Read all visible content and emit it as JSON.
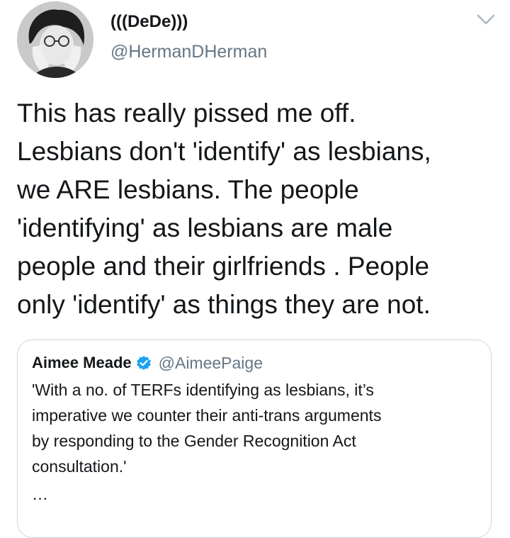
{
  "author": {
    "display_name": "(((DeDe)))",
    "handle": "@HermanDHerman",
    "avatar_icon": "user-avatar"
  },
  "tweet": {
    "text": "This has really pissed me off.\nLesbians don't 'identify' as lesbians,\nwe ARE lesbians. The people\n'identifying' as lesbians are male\npeople and their girlfriends . People\nonly 'identify' as things they are not."
  },
  "menu": {
    "icon": "chevron-down-icon"
  },
  "quoted_tweet": {
    "display_name": "Aimee Meade",
    "verified_icon": "verified-badge-icon",
    "handle": "@AimeePaige",
    "text": "'With a no. of TERFs identifying as lesbians, it’s\nimperative we counter their anti-trans arguments\nby responding to the Gender Recognition Act\nconsultation.'",
    "truncation": "…"
  },
  "colors": {
    "text_primary": "#14171a",
    "text_secondary": "#657786",
    "border": "#ccd6dd",
    "verified_blue": "#1da1f2"
  }
}
